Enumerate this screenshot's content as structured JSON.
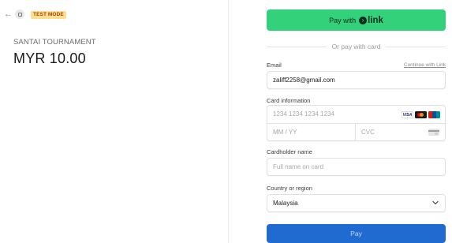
{
  "header": {
    "back_icon": "arrow-left-icon",
    "store_icon": "store-icon",
    "test_badge": "TEST MODE"
  },
  "product": {
    "name": "SANTAI TOURNAMENT",
    "price": "MYR 10.00"
  },
  "link_button": {
    "prefix": "Pay with",
    "brand": "link",
    "logo_glyph": "›",
    "color": "#33d17a"
  },
  "divider_text": "Or pay with card",
  "email": {
    "label": "Email",
    "continue_link": "Continue with Link",
    "value": "zaliff2258@gmail.com"
  },
  "card": {
    "label": "Card information",
    "number_placeholder": "1234 1234 1234 1234",
    "expiry_placeholder": "MM / YY",
    "cvc_placeholder": "CVC",
    "brands": [
      "visa-icon",
      "mastercard-icon",
      "unionpay-icon"
    ],
    "visa_text": "VISA"
  },
  "cardholder": {
    "label": "Cardholder name",
    "placeholder": "Full name on card"
  },
  "country": {
    "label": "Country or region",
    "selected": "Malaysia"
  },
  "pay_button": {
    "label": "Pay",
    "color": "#1f6bd0"
  }
}
